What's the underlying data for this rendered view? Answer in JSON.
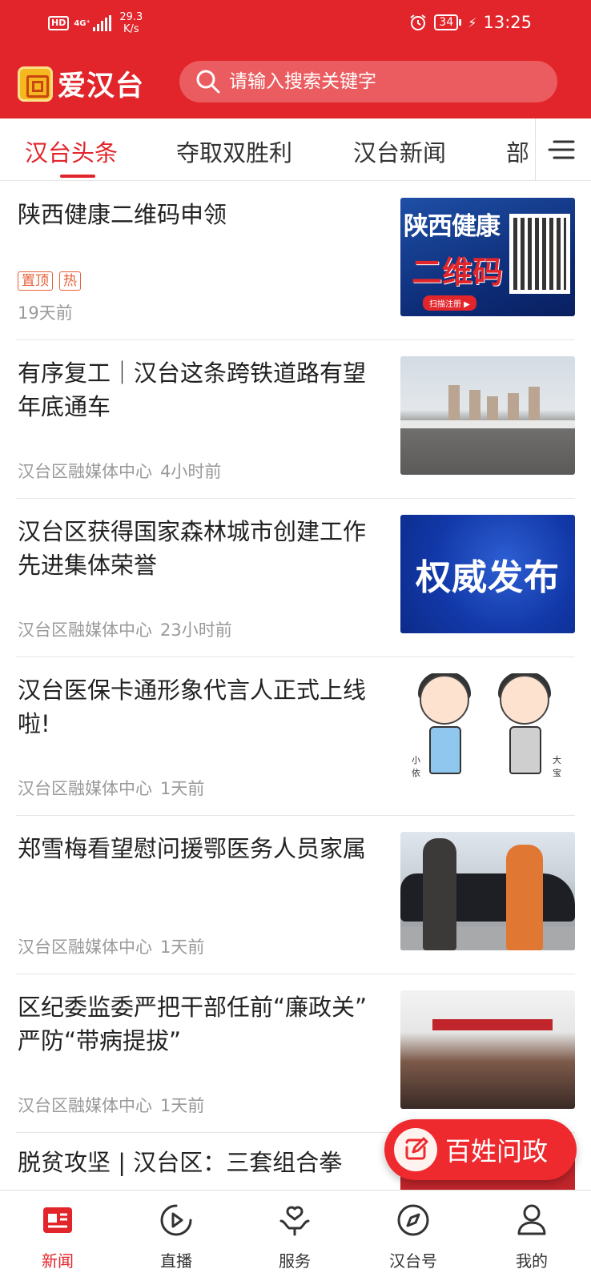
{
  "status_bar": {
    "hd": "HD",
    "network": "4G⁺",
    "speed_value": "29.3",
    "speed_unit": "K/s",
    "battery": "34",
    "time": "13:25"
  },
  "header": {
    "app_name": "爱汉台",
    "search_placeholder": "请输入搜索关键字"
  },
  "tabs": [
    {
      "label": "汉台头条",
      "active": true
    },
    {
      "label": "夺取双胜利",
      "active": false
    },
    {
      "label": "汉台新闻",
      "active": false
    },
    {
      "label": "部",
      "active": false
    }
  ],
  "news": [
    {
      "title": "陕西健康二维码申领",
      "tags": [
        "置顶",
        "热"
      ],
      "source": "",
      "time": "19天前",
      "thumb_text_1": "陕西健康",
      "thumb_text_2": "二维码",
      "thumb_button": "扫描注册 ▶"
    },
    {
      "title": "有序复工｜汉台这条跨铁道路有望年底通车",
      "source": "汉台区融媒体中心",
      "time": "4小时前"
    },
    {
      "title": "汉台区获得国家森林城市创建工作先进集体荣誉",
      "source": "汉台区融媒体中心",
      "time": "23小时前",
      "thumb_text": "权威发布"
    },
    {
      "title": "汉台医保卡通形象代言人正式上线啦!",
      "source": "汉台区融媒体中心",
      "time": "1天前",
      "thumb_label_left": "小\n依",
      "thumb_label_right": "大\n宝"
    },
    {
      "title": "郑雪梅看望慰问援鄂医务人员家属",
      "source": "汉台区融媒体中心",
      "time": "1天前"
    },
    {
      "title": "区纪委监委严把干部任前“廉政关” 严防“带病提拔”",
      "source": "汉台区融媒体中心",
      "time": "1天前"
    },
    {
      "title": "脱贫攻坚 | 汉台区：三套组合拳"
    }
  ],
  "fab": {
    "label": "百姓问政"
  },
  "bottom_nav": [
    {
      "label": "新闻",
      "icon": "news-icon",
      "active": true
    },
    {
      "label": "直播",
      "icon": "play-icon",
      "active": false
    },
    {
      "label": "服务",
      "icon": "service-icon",
      "active": false
    },
    {
      "label": "汉台号",
      "icon": "compass-icon",
      "active": false
    },
    {
      "label": "我的",
      "icon": "user-icon",
      "active": false
    }
  ],
  "colors": {
    "brand_red": "#e1252b",
    "tag_orange": "#e8603a",
    "meta_gray": "#999999"
  }
}
